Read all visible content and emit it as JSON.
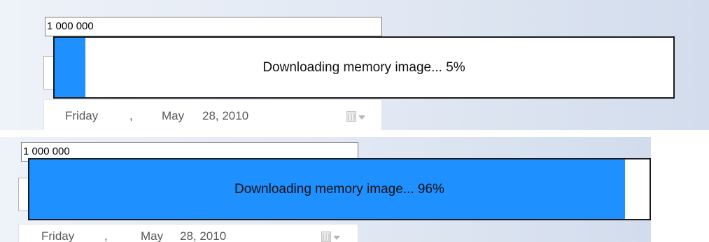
{
  "panels": [
    {
      "number_field": {
        "value": "1 000 000"
      },
      "date_picker": {
        "weekday": "Friday",
        "separator": ",",
        "month": "May",
        "day_year": "28, 2010"
      },
      "progress": {
        "text": "Downloading memory image... 5%",
        "percent": 5,
        "color": "#1e90ff"
      }
    },
    {
      "number_field": {
        "value": "1 000 000"
      },
      "date_picker": {
        "weekday": "Friday",
        "separator": ",",
        "month": "May",
        "day_year": "28, 2010"
      },
      "progress": {
        "text": "Downloading memory image... 96%",
        "percent": 96,
        "color": "#1e90ff"
      }
    }
  ],
  "icons": {
    "calendar": "calendar-icon",
    "dropdown": "chevron-down-icon"
  }
}
